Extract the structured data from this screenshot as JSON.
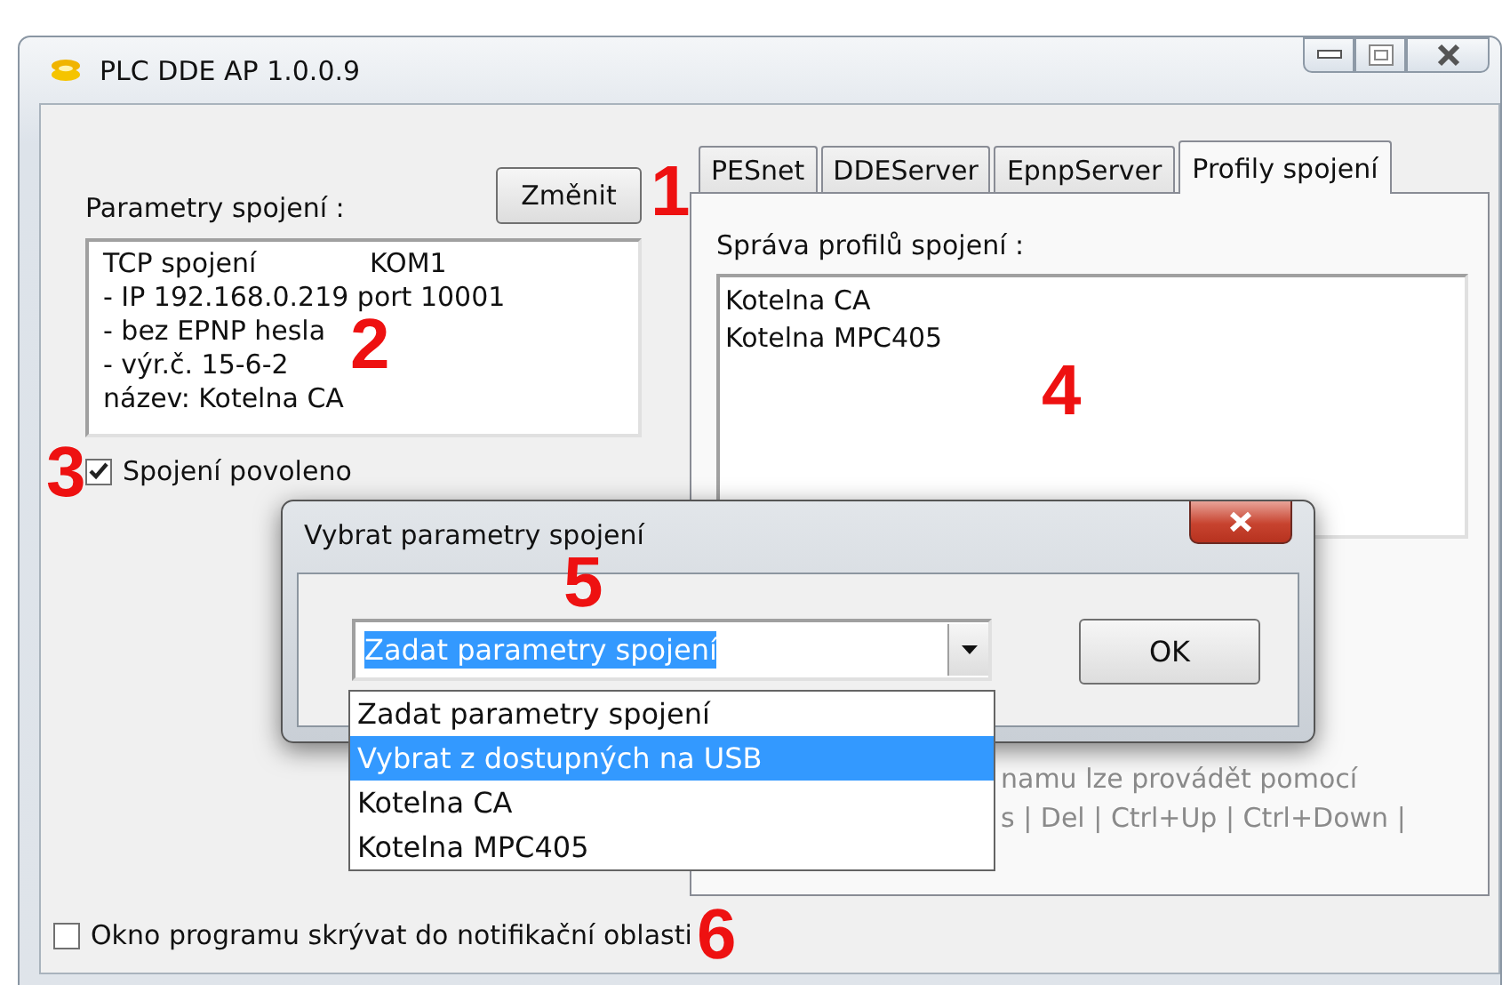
{
  "window": {
    "title": "PLC DDE AP 1.0.0.9"
  },
  "connection": {
    "label": "Parametry spojení :",
    "change_button": "Změnit",
    "type": "TCP spojení",
    "port": "KOM1",
    "lines": [
      "- IP 192.168.0.219 port 10001",
      "- bez EPNP hesla",
      "- výr.č.  15-6-2",
      "název: Kotelna CA"
    ],
    "enabled": {
      "label": "Spojení povoleno",
      "checked": true
    }
  },
  "tabs": [
    {
      "label": "PESnet",
      "selected": false
    },
    {
      "label": "DDEServer",
      "selected": false
    },
    {
      "label": "EpnpServer",
      "selected": false
    },
    {
      "label": "Profily spojení",
      "selected": true
    }
  ],
  "profiles": {
    "label": "Správa profilů spojení :",
    "items": [
      "Kotelna CA",
      "Kotelna MPC405"
    ],
    "hint_lines": [
      "namu lze provádět pomocí",
      "s | Del | Ctrl+Up | Ctrl+Down |"
    ]
  },
  "tray_option": {
    "label": "Okno programu skrývat do notifikační oblasti",
    "checked": false
  },
  "dialog": {
    "title": "Vybrat parametry spojení",
    "combo_value": "Zadat parametry spojení",
    "ok_button": "OK",
    "options": [
      {
        "label": "Zadat parametry spojení",
        "selected": false
      },
      {
        "label": "Vybrat z dostupných na USB",
        "selected": true
      },
      {
        "label": "Kotelna CA",
        "selected": false
      },
      {
        "label": "Kotelna MPC405",
        "selected": false
      }
    ]
  },
  "annotations": [
    "1",
    "2",
    "3",
    "4",
    "5",
    "6"
  ]
}
